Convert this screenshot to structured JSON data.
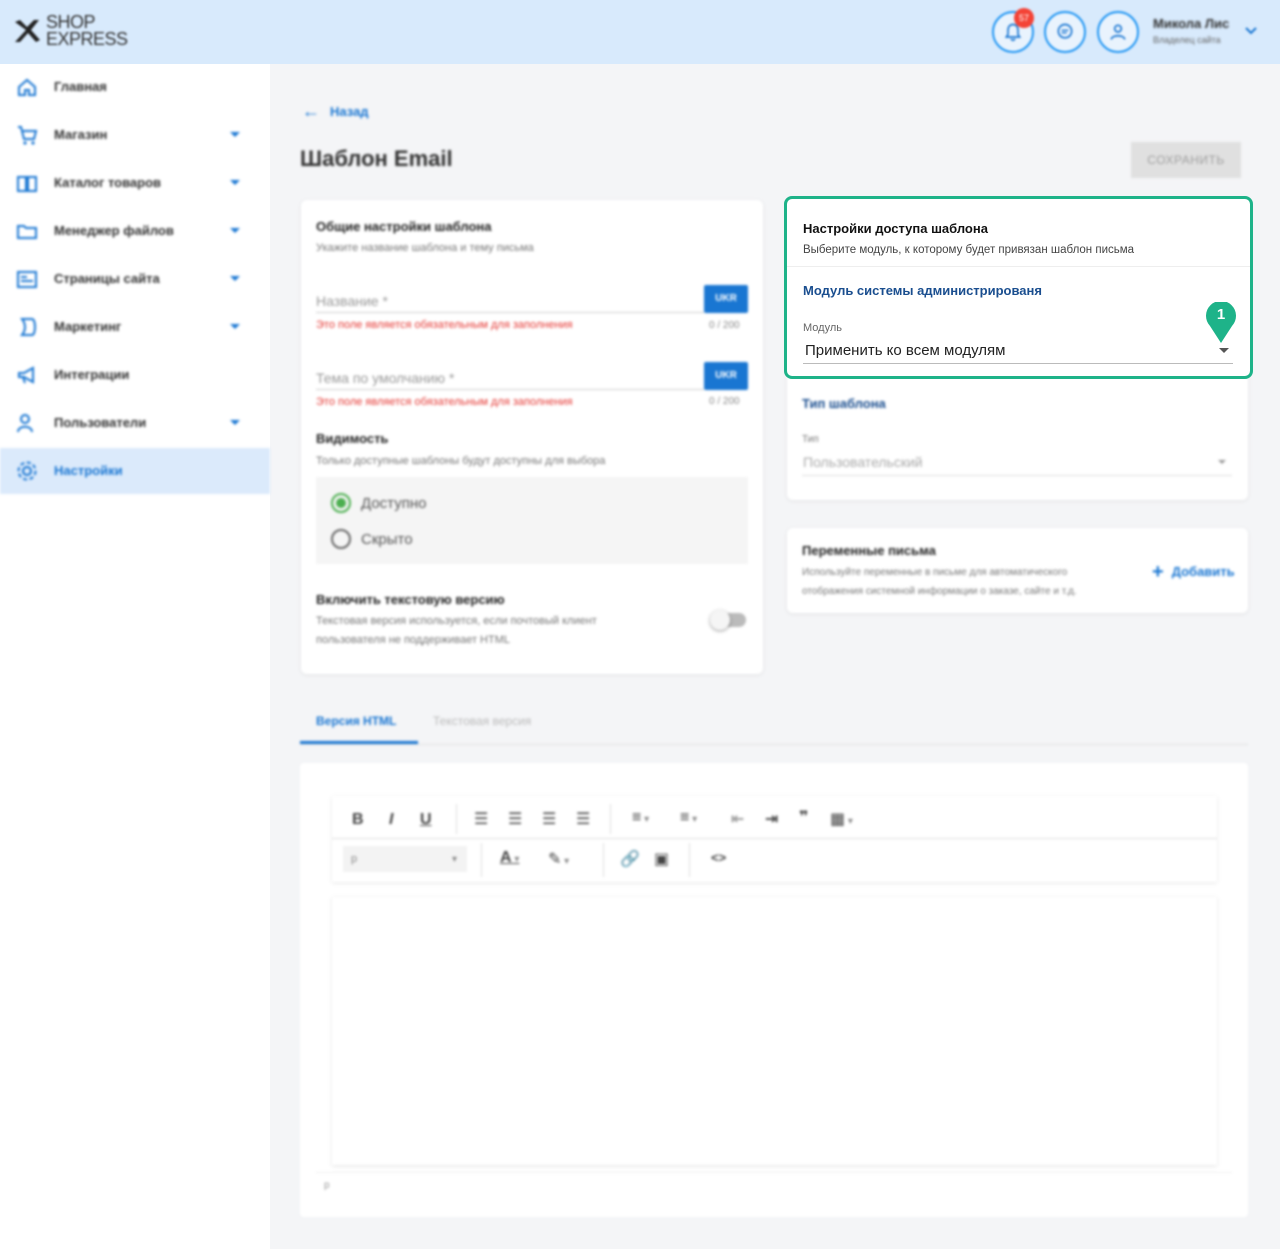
{
  "header": {
    "logo": {
      "line1": "SHOP",
      "line2": "EXPRESS"
    },
    "notifications_badge": "57",
    "user_name": "Микола Лис",
    "user_role": "Владелец сайта"
  },
  "sidebar": {
    "items": [
      {
        "label": "Главная",
        "icon": "home-icon",
        "has_submenu": false
      },
      {
        "label": "Магазин",
        "icon": "cart-icon",
        "has_submenu": true
      },
      {
        "label": "Каталог товаров",
        "icon": "book-icon",
        "has_submenu": true
      },
      {
        "label": "Менеджер файлов",
        "icon": "folder-icon",
        "has_submenu": true
      },
      {
        "label": "Страницы сайта",
        "icon": "pages-icon",
        "has_submenu": true
      },
      {
        "label": "Маркетинг",
        "icon": "marketing-icon",
        "has_submenu": true
      },
      {
        "label": "Интеграции",
        "icon": "megaphone-icon",
        "has_submenu": false
      },
      {
        "label": "Пользователи",
        "icon": "users-icon",
        "has_submenu": true
      },
      {
        "label": "Настройки",
        "icon": "gear-icon",
        "has_submenu": false,
        "active": true
      }
    ]
  },
  "main": {
    "back_label": "Назад",
    "title": "Шаблон Email",
    "save_label": "СОХРАНИТЬ",
    "general": {
      "title": "Общие настройки шаблона",
      "subtitle": "Укажите название шаблона и тему письма",
      "name_placeholder": "Название *",
      "subject_placeholder": "Тема по умолчанию *",
      "lang": "UKR",
      "error": "Это поле является обязательным для заполнения",
      "counter": "0 / 200",
      "visibility_title": "Видимость",
      "visibility_sub": "Только доступные шаблоны будут доступны для выбора",
      "opt_available": "Доступно",
      "opt_hidden": "Скрыто",
      "text_version_title": "Включить текстовую версию",
      "text_version_sub1": "Текстовая версия используется, если почтовый клиент",
      "text_version_sub2": "пользователя не поддерживает HTML"
    },
    "access": {
      "title": "Настройки доступа шаблона",
      "subtitle": "Выберите модуль, к которому будет привязан шаблон письма",
      "module_title": "Модуль системы администрированя",
      "module_label": "Модуль",
      "module_value": "Применить ко всем модулям",
      "marker": "1",
      "accent": "#1eb389"
    },
    "template_type": {
      "title": "Тип шаблона",
      "label": "Тип",
      "value": "Пользовательский"
    },
    "variables": {
      "title": "Переменные письма",
      "sub1": "Используйте переменные в письме для автоматического",
      "sub2": "отображения системной информации о заказе, сайте и т.д.",
      "add_label": "Добавить"
    },
    "tabs": [
      {
        "label": "Версия HTML",
        "active": true
      },
      {
        "label": "Текстовая версия",
        "active": false
      }
    ],
    "editor": {
      "paragraph": "p",
      "status": "p"
    }
  }
}
